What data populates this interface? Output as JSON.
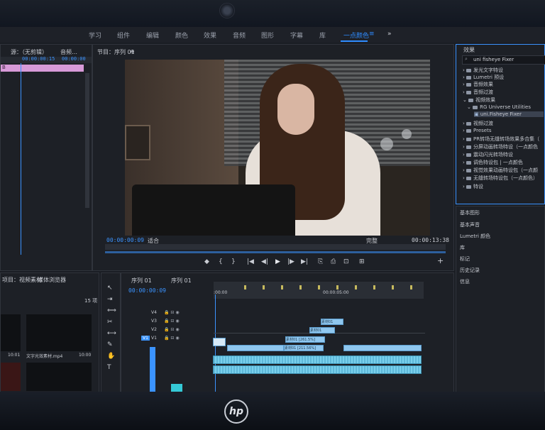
{
  "menu": {
    "items": [
      "学习",
      "组件",
      "编辑",
      "颜色",
      "效果",
      "音频",
      "图形",
      "字幕",
      "库",
      "一点颜色"
    ],
    "active_index": 9,
    "overflow": "»",
    "active_menu_icon": "≡"
  },
  "source_panel": {
    "title": "源：（无剪辑）",
    "tab2": "音频…",
    "timecode_a": "00:00:00:15",
    "timecode_b": "00:00:00",
    "left_clip_label": "B"
  },
  "program_monitor": {
    "title": "节目：序列 01",
    "menu_icon": "≡",
    "current_tc": "00:00:00:09",
    "fit": "适合",
    "quality": "完整",
    "duration_tc": "00:00:13:38",
    "controls": [
      "◆",
      "{",
      "}",
      "|◀",
      "◀|",
      "▶",
      "|▶",
      "▶|",
      "⎘",
      "⎙",
      "⊡",
      "⊞"
    ]
  },
  "effects": {
    "title": "效果",
    "search_value": "uni fisheye Fixer",
    "items": [
      {
        "label": "发光文字特设",
        "indent": 0
      },
      {
        "label": "Lumetri 预设",
        "indent": 0
      },
      {
        "label": "音频效果",
        "indent": 0
      },
      {
        "label": "音频过渡",
        "indent": 0
      },
      {
        "label": "视频效果",
        "indent": 0
      },
      {
        "label": "RG Universe Utilities",
        "indent": 1
      },
      {
        "label": "uni.Fisheye Fixer",
        "indent": 2,
        "selected": true
      },
      {
        "label": "视频过渡",
        "indent": 0
      },
      {
        "label": "Presets",
        "indent": 0
      },
      {
        "label": "PR转场无缝转场效果多合集（",
        "indent": 0
      },
      {
        "label": "分屏动画转场特设（一点颜色",
        "indent": 0
      },
      {
        "label": "震动闪光转场特设",
        "indent": 0
      },
      {
        "label": "调色特设包 | 一点颜色",
        "indent": 0
      },
      {
        "label": "视觉效果动画特设包（一点颜",
        "indent": 0
      },
      {
        "label": "无缝转场特设包（一点颜色）",
        "indent": 0
      },
      {
        "label": "特设",
        "indent": 0
      }
    ],
    "side_panels": [
      "基本图形",
      "基本声音",
      "Lumetri 颜色",
      "库",
      "标记",
      "历史记录",
      "信息"
    ]
  },
  "project_panel": {
    "tab_project": "项目：视频素材",
    "tab_browser": "媒体浏览器",
    "count": "15 项",
    "item1_duration": "10:01",
    "item2_name": "文字光效素材.mp4",
    "item2_duration": "10:00"
  },
  "timeline": {
    "tab": "序列 01",
    "tab2": "序列 01",
    "timecode": "00:00:00:09",
    "ruler_start": ":00:00",
    "ruler_mid": "00:00:05:00",
    "tracks": [
      "V4",
      "V3",
      "V2",
      "V1"
    ],
    "v1_target": "V1",
    "clips": [
      {
        "label": "素材01",
        "track": "V4"
      },
      {
        "label": "素材01",
        "track": "V3"
      },
      {
        "label": "素材01 [261.5%]",
        "track": "V2"
      },
      {
        "label": "素材01 [211.56%]",
        "track": "V1"
      }
    ]
  },
  "colors": {
    "accent": "#3b93ff",
    "clip": "#8fc7ef",
    "audio": "#6cc4e4",
    "panel": "#1d2026",
    "teal_swatch": "#35c9d6"
  }
}
